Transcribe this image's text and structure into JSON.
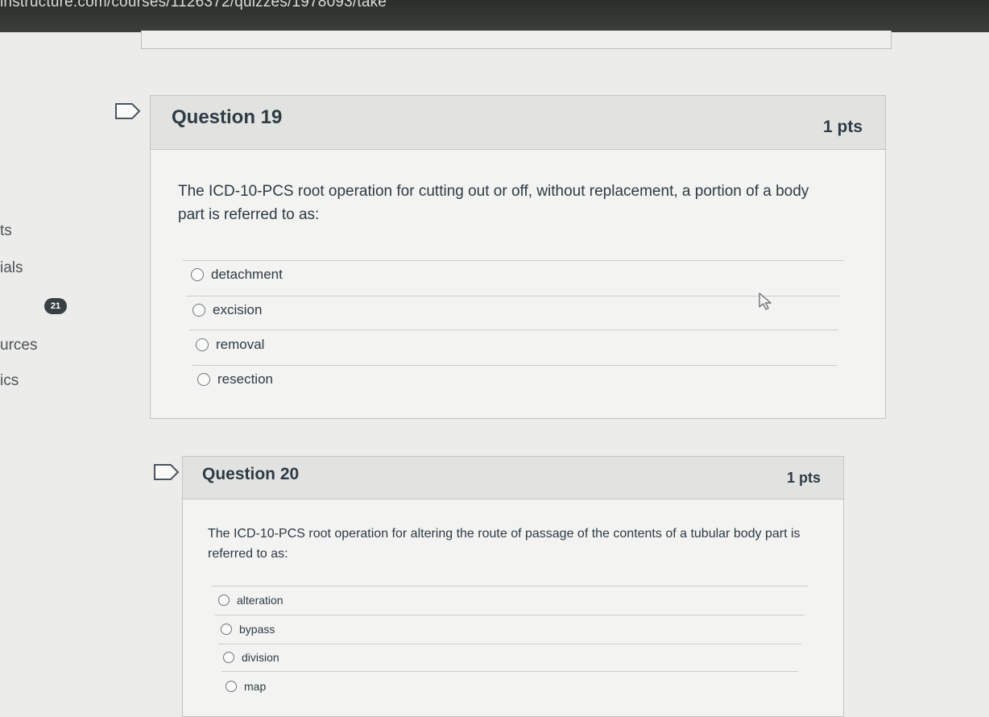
{
  "browser": {
    "url": "instructure.com/courses/1126372/quizzes/1978093/take"
  },
  "left_nav": {
    "items": [
      "ts",
      "ials",
      "urces",
      "ics"
    ],
    "badge": "21"
  },
  "questions": [
    {
      "title": "Question 19",
      "points": "1 pts",
      "text": "The ICD-10-PCS root operation for cutting out or off, without replacement, a portion of a body part is referred to as:",
      "answers": [
        "detachment",
        "excision",
        "removal",
        "resection"
      ]
    },
    {
      "title": "Question 20",
      "points": "1 pts",
      "text": "The ICD-10-PCS root operation for altering the route of passage of the contents of a tubular body part is referred to as:",
      "answers": [
        "alteration",
        "bypass",
        "division",
        "map"
      ]
    }
  ]
}
